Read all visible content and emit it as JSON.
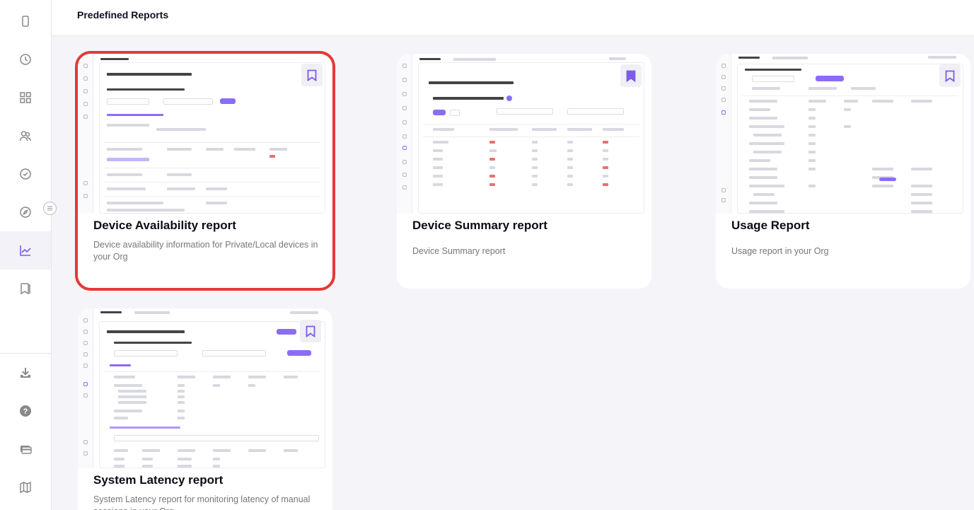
{
  "header": {
    "title": "Predefined Reports"
  },
  "sidebar": {
    "items": [
      {
        "name": "device-icon"
      },
      {
        "name": "clock-icon"
      },
      {
        "name": "grid-icon"
      },
      {
        "name": "users-icon"
      },
      {
        "name": "check-circle-icon"
      },
      {
        "name": "compass-icon"
      },
      {
        "name": "chart-icon",
        "active": true
      },
      {
        "name": "book-icon"
      },
      {
        "name": "download-icon"
      },
      {
        "name": "help-icon"
      },
      {
        "name": "card-icon"
      },
      {
        "name": "map-icon"
      }
    ]
  },
  "cards": [
    {
      "title": "Device Availability report",
      "description": "Device availability information for Private/Local devices in your Org",
      "selected": true
    },
    {
      "title": "Device Summary report",
      "description": "Device Summary report"
    },
    {
      "title": "Usage Report",
      "description": "Usage report in your Org"
    },
    {
      "title": "System Latency report",
      "description": "System Latency report for monitoring latency of manual sessions in your Org"
    }
  ],
  "colors": {
    "accent": "#8b6cf6",
    "selected_border": "#e53935",
    "background": "#f5f5f9"
  }
}
